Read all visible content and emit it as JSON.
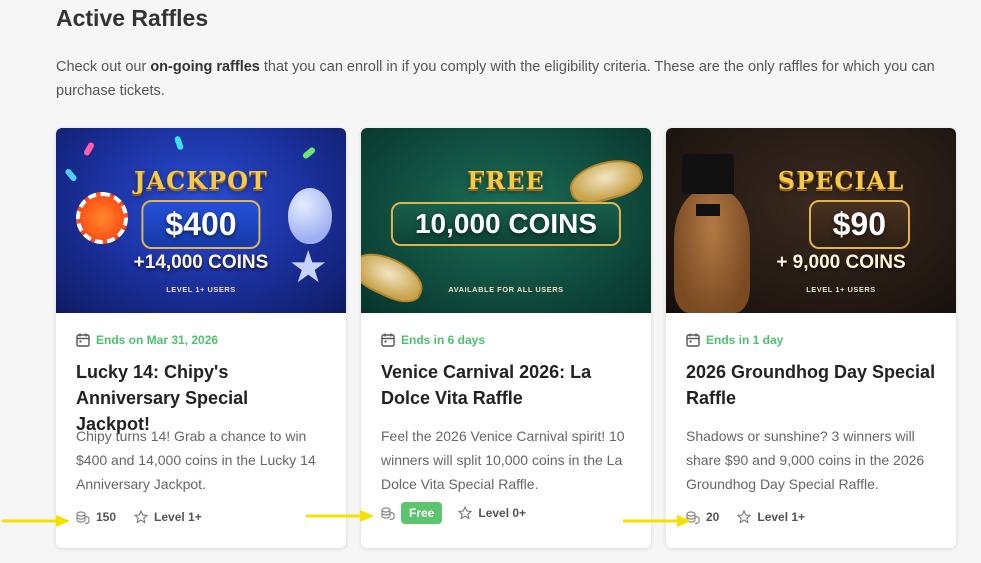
{
  "header": {
    "title": "Active Raffles",
    "intro_pre": "Check out our ",
    "intro_bold": "on-going raffles",
    "intro_post": " that you can enroll in if you comply with the eligibility criteria. These are the only raffles for which you can purchase tickets."
  },
  "raffles": [
    {
      "banner_head": "JACKPOT",
      "banner_amount": "$400",
      "banner_sub": "+14,000 COINS",
      "banner_note": "LEVEL 1+ USERS",
      "ends": "Ends on Mar 31, 2026",
      "title": "Lucky 14: Chipy's Anniversary Special Jackpot!",
      "description": "Chipy turns 14! Grab a chance to win $400 and 14,000 coins in the Lucky 14 Anniversary Jackpot.",
      "price": "150",
      "level": "Level 1+"
    },
    {
      "banner_head": "FREE",
      "banner_amount": "10,000 COINS",
      "banner_note": "AVAILABLE FOR ALL USERS",
      "ends": "Ends in 6 days",
      "title": "Venice Carnival 2026: La Dolce Vita Raffle",
      "description": "Feel the 2026 Venice Carnival spirit! 10 winners will split 10,000 coins in the La Dolce Vita Special Raffle.",
      "price_badge": "Free",
      "level": "Level 0+"
    },
    {
      "banner_head": "SPECIAL",
      "banner_amount": "$90",
      "banner_sub": "+ 9,000 COINS",
      "banner_note": "LEVEL 1+ USERS",
      "ends": "Ends in 1 day",
      "title": "2026 Groundhog Day Special Raffle",
      "description": "Shadows or sunshine? 3 winners will share $90 and 9,000 coins in the 2026 Groundhog Day Special Raffle.",
      "price": "20",
      "level": "Level 1+"
    }
  ],
  "colors": {
    "accent_green": "#4cc26c",
    "badge_green": "#5cc46f",
    "arrow_yellow": "#f5e000"
  }
}
